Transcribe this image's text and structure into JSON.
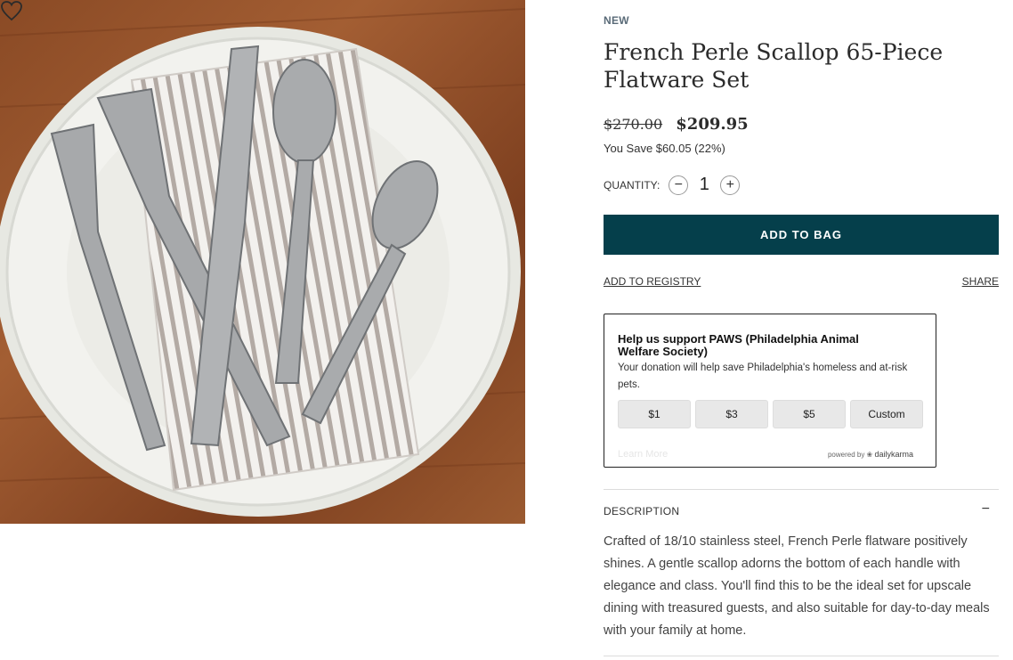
{
  "product": {
    "badge": "NEW",
    "title": "French Perle Scallop 65-Piece Flatware Set",
    "old_price": "$270.00",
    "price": "$209.95",
    "savings": "You Save $60.05 (22%)"
  },
  "quantity": {
    "label": "QUANTITY:",
    "value": "1",
    "minus": "−",
    "plus": "+"
  },
  "actions": {
    "add_to_bag": "ADD TO BAG",
    "add_to_registry": "ADD TO REGISTRY",
    "share": "SHARE"
  },
  "donation": {
    "title": "Help us support PAWS (Philadelphia Animal Welfare Society)",
    "text": "Your donation will help save Philadelphia's homeless and at-risk pets.",
    "amounts": [
      "$1",
      "$3",
      "$5",
      "Custom"
    ],
    "learn_more": "Learn More",
    "powered_by": "powered by",
    "brand": "dailykarma"
  },
  "description": {
    "heading": "DESCRIPTION",
    "toggle": "−",
    "body": "Crafted of 18/10 stainless steel, French Perle flatware positively shines. A gentle scallop adorns the bottom of each handle with elegance and class. You'll find this to be the ideal set for upscale dining with treasured guests, and also suitable for day-to-day meals with your family at home."
  },
  "colors": {
    "accent": "#053f4b",
    "table_wood": "#8a4a25"
  },
  "icons": {
    "favorite": "heart-outline-icon"
  }
}
